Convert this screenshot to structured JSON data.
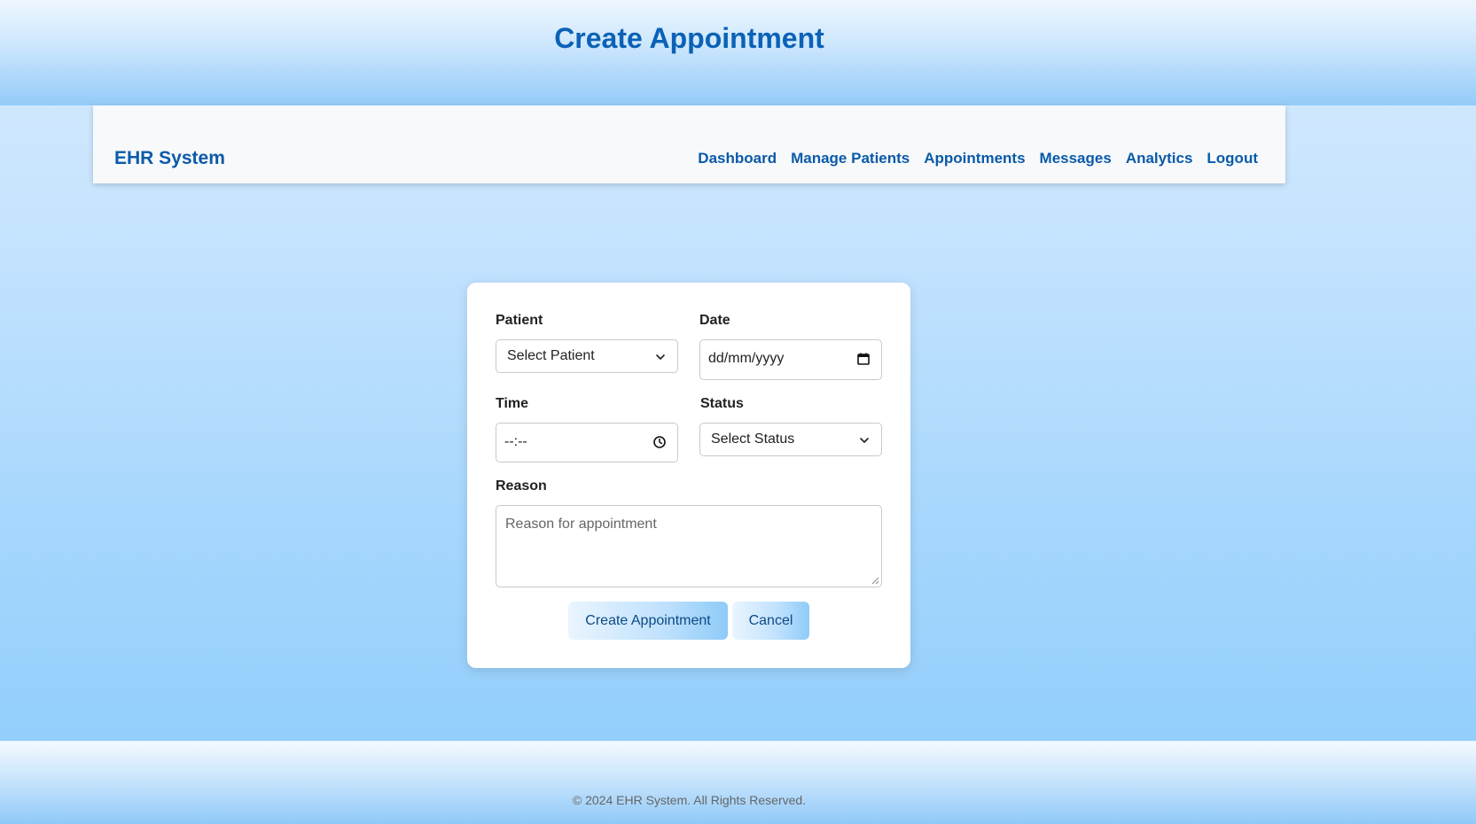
{
  "header": {
    "title": "Create Appointment"
  },
  "navbar": {
    "brand": "EHR System",
    "links": [
      "Dashboard",
      "Manage Patients",
      "Appointments",
      "Messages",
      "Analytics",
      "Logout"
    ]
  },
  "form": {
    "patient": {
      "label": "Patient",
      "value": "Select Patient"
    },
    "date": {
      "label": "Date",
      "value": "dd/mm/yyyy"
    },
    "time": {
      "label": "Time",
      "value": "--:--"
    },
    "status": {
      "label": "Status",
      "value": "Select Status"
    },
    "reason": {
      "label": "Reason",
      "placeholder": "Reason for appointment"
    },
    "buttons": {
      "create": "Create Appointment",
      "cancel": "Cancel"
    }
  },
  "footer": {
    "text": "© 2024 EHR System. All Rights Reserved."
  },
  "icons": {
    "patient_dropdown": "chevron-down-icon",
    "status_dropdown": "chevron-down-icon",
    "date_picker": "calendar-icon",
    "time_picker": "clock-icon"
  },
  "colors": {
    "accent": "#0b5aa8",
    "title": "#0b62b6"
  }
}
